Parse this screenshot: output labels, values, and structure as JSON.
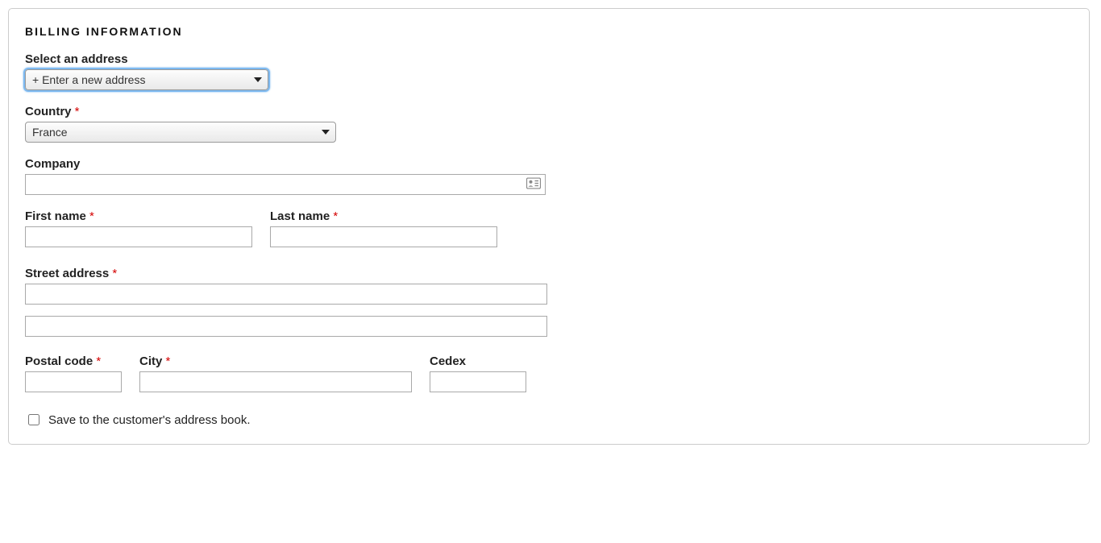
{
  "section_title": "BILLING INFORMATION",
  "fields": {
    "select_address": {
      "label": "Select an address",
      "value": "+ Enter a new address"
    },
    "country": {
      "label": "Country",
      "required": true,
      "value": "France"
    },
    "company": {
      "label": "Company",
      "value": ""
    },
    "first_name": {
      "label": "First name",
      "required": true,
      "value": ""
    },
    "last_name": {
      "label": "Last name",
      "required": true,
      "value": ""
    },
    "street_address": {
      "label": "Street address",
      "required": true,
      "line1": "",
      "line2": ""
    },
    "postal_code": {
      "label": "Postal code",
      "required": true,
      "value": ""
    },
    "city": {
      "label": "City",
      "required": true,
      "value": ""
    },
    "cedex": {
      "label": "Cedex",
      "value": ""
    },
    "save_to_book": {
      "label": "Save to the customer's address book.",
      "checked": false
    }
  },
  "required_marker": "*"
}
